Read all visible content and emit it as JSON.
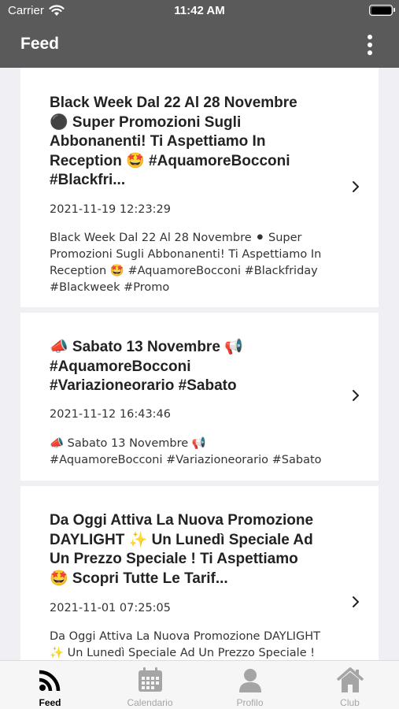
{
  "status_bar": {
    "carrier": "Carrier",
    "time": "11:42 AM",
    "icons": [
      "wifi-icon",
      "battery-icon"
    ]
  },
  "nav": {
    "title": "Feed",
    "menu_icon": "more-vertical-icon"
  },
  "feed": {
    "items": [
      {
        "title_lines": [
          "Black Week Dal 22 Al 28 Novembre",
          "⚫ Super Promozioni Sugli",
          "Abbonanenti! Ti Aspettiamo In",
          "Reception 🤩 #AquamoreBocconi",
          "#Blackfri..."
        ],
        "date": "2021-11-19 12:23:29",
        "body_lines": [
          "Black Week Dal 22 Al 28 Novembre ⚫ Super",
          "Promozioni Sugli Abbonanenti! Ti Aspettiamo In",
          "Reception 🤩 #AquamoreBocconi #Blackfriday",
          "#Blackweek #Promo"
        ]
      },
      {
        "title_lines": [
          "📣 Sabato 13 Novembre 📢",
          "#AquamoreBocconi",
          "#Variazioneorario #Sabato"
        ],
        "date": "2021-11-12 16:43:46",
        "body_lines": [
          "📣 Sabato 13 Novembre 📢",
          "#AquamoreBocconi #Variazioneorario #Sabato"
        ]
      },
      {
        "title_lines": [
          "Da Oggi Attiva La Nuova Promozione",
          "DAYLIGHT ✨ Un Lunedì Speciale Ad",
          "Un Prezzo Speciale ! Ti Aspettiamo",
          "🤩 Scopri Tutte Le Tarif..."
        ],
        "date": "2021-11-01 07:25:05",
        "body_lines": [
          "Da Oggi Attiva La Nuova Promozione DAYLIGHT",
          "✨ Un Lunedì Speciale Ad Un Prezzo Speciale !"
        ]
      }
    ]
  },
  "tabs": [
    {
      "label": "Feed",
      "icon": "rss-icon",
      "active": true
    },
    {
      "label": "Calendario",
      "icon": "calendar-icon",
      "active": false
    },
    {
      "label": "Profilo",
      "icon": "user-icon",
      "active": false
    },
    {
      "label": "Club",
      "icon": "home-icon",
      "active": false
    }
  ],
  "colors": {
    "header_bg": "#5a5a5a",
    "background": "#efeff4",
    "tab_active": "#000000",
    "tab_inactive": "#a5a5a5"
  }
}
